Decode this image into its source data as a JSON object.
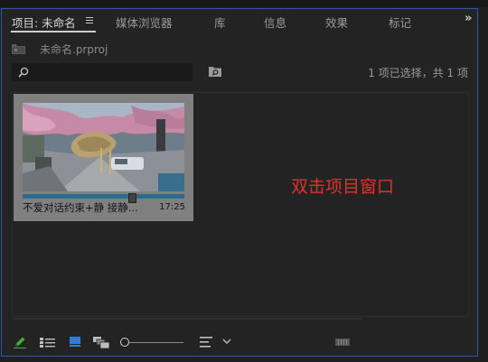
{
  "tabs": [
    {
      "label": "项目: 未命名",
      "active": true
    },
    {
      "label": "媒体浏览器"
    },
    {
      "label": "库"
    },
    {
      "label": "信息"
    },
    {
      "label": "效果"
    },
    {
      "label": "标记"
    }
  ],
  "project": {
    "filename": "未命名.prproj"
  },
  "search": {
    "placeholder": ""
  },
  "status": "1 项已选择，共 1 项",
  "clip": {
    "name": "不爱对话约束+静 接静...",
    "duration": "17:25",
    "usage_fraction": 0.7
  },
  "annotation": "双击项目窗口",
  "colors": {
    "accent": "#2b5aa8",
    "annotation": "#e0322d",
    "pencil": "#3fae3f",
    "icon_view": "#2f7fd9",
    "usage_bar": "#2c6a8e"
  },
  "icons": [
    "folder-icon",
    "search-icon",
    "bin-search-icon",
    "overflow-icon",
    "menu-icon",
    "pencil-icon",
    "list-icon",
    "icon-view-icon",
    "freeform-icon",
    "sort-icon",
    "chevron-down-icon",
    "scroll-grip-icon"
  ]
}
